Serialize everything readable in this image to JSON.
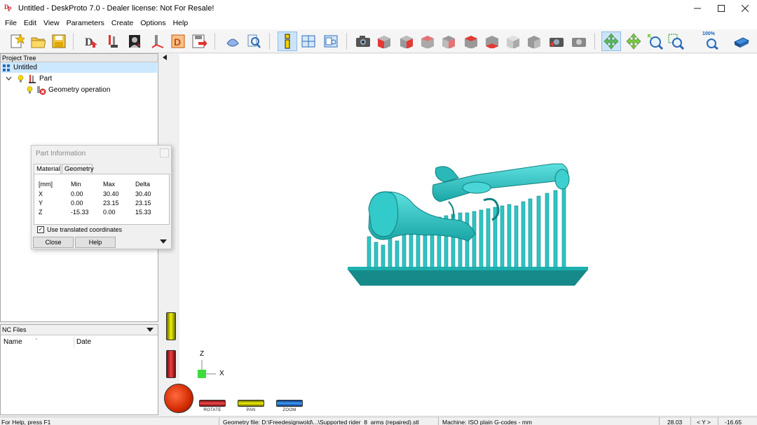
{
  "window": {
    "title": "Untitled - DeskProto 7.0 - Dealer license: Not For Resale!",
    "logo_text_1": "D",
    "logo_text_2": "P"
  },
  "menu": [
    "File",
    "Edit",
    "View",
    "Parameters",
    "Create",
    "Options",
    "Help"
  ],
  "toolbar": {
    "zoom_label": "100%",
    "accent": "#cde4f7"
  },
  "project_tree": {
    "header": "Project Tree",
    "root": "Untitled",
    "part": "Part",
    "operation": "Geometry operation"
  },
  "nc_files": {
    "header": "NC Files",
    "col_name": "Name",
    "col_date": "Date"
  },
  "part_info": {
    "title": "Part Information",
    "tabs": [
      "Material",
      "Geometry"
    ],
    "headers": [
      "[mm]",
      "Min",
      "Max",
      "Delta"
    ],
    "rows": [
      [
        "X",
        "0.00",
        "30.40",
        "30.40"
      ],
      [
        "Y",
        "0.00",
        "23.15",
        "23.15"
      ],
      [
        "Z",
        "-15.33",
        "0.00",
        "15.33"
      ]
    ],
    "checkbox_label": "Use translated coordinates",
    "checkbox_checked": true,
    "close_label": "Close",
    "help_label": "Help"
  },
  "viewport": {
    "axis_z": "Z",
    "axis_x": "X",
    "model_color": "#2ec4c4",
    "sliders": [
      "ROTATE",
      "PAN",
      "ZOOM"
    ]
  },
  "statusbar": {
    "help": "For Help, press F1",
    "geometry": "Geometry file: D:\\Freedesignwold\\...\\Supported rider_8_arms (repaired).stl",
    "machine": "Machine: ISO plain G-codes - mm",
    "coord_x": "28.03",
    "axis": "< Y >",
    "coord_y": "-16.65"
  }
}
